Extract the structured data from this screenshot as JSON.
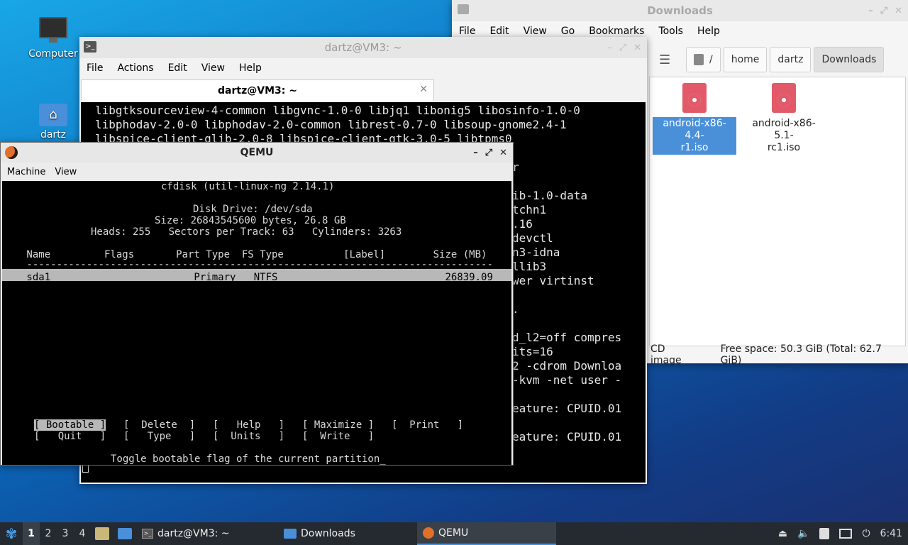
{
  "desktop": {
    "icons": [
      {
        "label": "Computer",
        "icon": "computer-icon"
      },
      {
        "label": "dartz",
        "icon": "home-folder-icon",
        "glyph": "⌂"
      }
    ]
  },
  "file_manager": {
    "title": "Downloads",
    "menu": [
      "File",
      "Edit",
      "View",
      "Go",
      "Bookmarks",
      "Tools",
      "Help"
    ],
    "path": [
      "/",
      "home",
      "dartz",
      "Downloads"
    ],
    "files": [
      {
        "name": "android-x86-4.4-r1.iso",
        "line1": "android-x86-4.4-",
        "line2": "r1.iso",
        "selected": true
      },
      {
        "name": "android-x86-5.1-rc1.iso",
        "line1": "android-x86-5.1-",
        "line2": "rc1.iso",
        "selected": false
      }
    ],
    "status": {
      "type": "CD image",
      "free": "Free space: 50.3 GiB (Total: 62.7 GiB)"
    }
  },
  "terminal": {
    "title": "dartz@VM3: ~",
    "menu": [
      "File",
      "Actions",
      "Edit",
      "View",
      "Help"
    ],
    "tab_label": "dartz@VM3: ~",
    "lines_full": [
      "libgtksourceview-4-common libgvnc-1.0-0 libjq1 libonig5 libosinfo-1.0-0",
      "libphodav-2.0-0 libphodav-2.0-common librest-0.7-0 libsoup-gnome2.4-1",
      "libspice-client-glib-2.0-8 libspice-client-gtk-3.0-5 libtpms0"
    ],
    "lines_right": [
      "r",
      "",
      "ib-1.0-data",
      "tchn1",
      ".16",
      "devctl",
      "n3-idna",
      "llib3",
      "wer virtinst",
      "",
      ".",
      "",
      "d_l2=off compres",
      "its=16",
      "2 -cdrom Downloa",
      "-kvm -net user -",
      "",
      "eature: CPUID.01",
      "",
      "eature: CPUID.01"
    ]
  },
  "qemu": {
    "title": "QEMU",
    "menu": [
      "Machine",
      "View"
    ],
    "screen": {
      "header": "cfdisk (util-linux-ng 2.14.1)",
      "disk_drive": "Disk Drive: /dev/sda",
      "size": "Size: 26843545600 bytes, 26.8 GB",
      "geometry": "Heads: 255   Sectors per Track: 63   Cylinders: 3263",
      "columns": " Name         Flags       Part Type  FS Type          [Label]        Size (MB)",
      "rule": " ------------------------------------------------------------------------------",
      "partition": " sda1                        Primary   NTFS                            26839.09",
      "buttons_row1": [
        {
          "label": "[ Bootable ]",
          "selected": true
        },
        {
          "label": "[  Delete  ]",
          "selected": false
        },
        {
          "label": "[   Help   ]",
          "selected": false
        },
        {
          "label": "[ Maximize ]",
          "selected": false
        },
        {
          "label": "[  Print   ]",
          "selected": false
        }
      ],
      "buttons_row2": [
        {
          "label": "[   Quit   ]"
        },
        {
          "label": "[   Type   ]"
        },
        {
          "label": "[  Units   ]"
        },
        {
          "label": "[  Write   ]"
        }
      ],
      "help_text": "Toggle bootable flag of the current partition_"
    }
  },
  "taskbar": {
    "workspaces": [
      "1",
      "2",
      "3",
      "4"
    ],
    "active_workspace": "1",
    "tasks": [
      {
        "label": "dartz@VM3: ~",
        "icon": "terminal-icon"
      },
      {
        "label": "Downloads",
        "icon": "folder-icon"
      },
      {
        "label": "QEMU",
        "icon": "qemu-icon"
      }
    ],
    "clock": "6:41"
  },
  "colors": {
    "selection": "#4a90d9",
    "terminal_bg": "#000000",
    "taskbar_bg": "#252a30"
  }
}
